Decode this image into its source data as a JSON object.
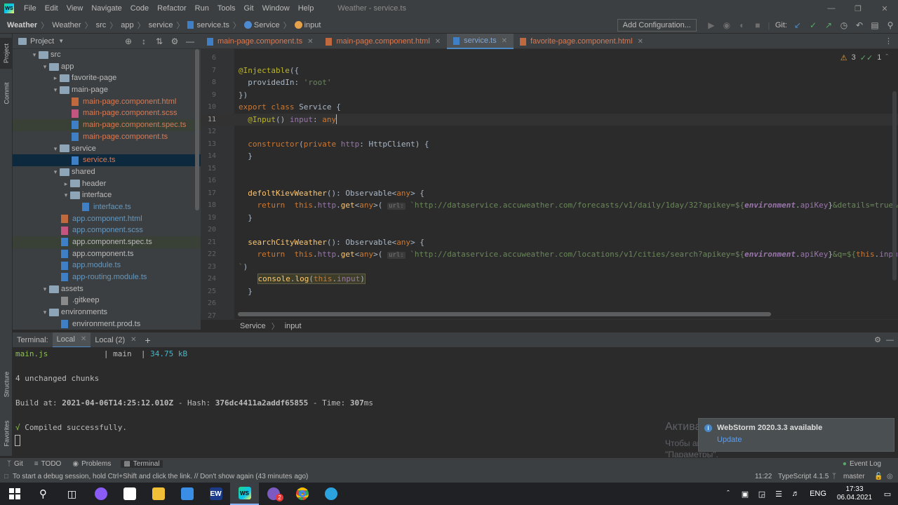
{
  "titlebar": {
    "logo": "WS",
    "menu": [
      "File",
      "Edit",
      "View",
      "Navigate",
      "Code",
      "Refactor",
      "Run",
      "Tools",
      "Git",
      "Window",
      "Help"
    ],
    "window_title": "Weather - service.ts"
  },
  "navbar": {
    "crumbs": [
      "Weather",
      "Weather",
      "src",
      "app",
      "service",
      "service.ts",
      "Service",
      "input"
    ],
    "add_config": "Add Configuration...",
    "git_label": "Git:"
  },
  "left_strip": {
    "project": "Project",
    "commit": "Commit",
    "structure": "Structure",
    "favorites": "Favorites"
  },
  "project": {
    "title": "Project",
    "tree": [
      {
        "label": "src",
        "type": "dir",
        "indent": 1,
        "arrow": "▾"
      },
      {
        "label": "app",
        "type": "dir",
        "indent": 2,
        "arrow": "▾"
      },
      {
        "label": "favorite-page",
        "type": "dir",
        "indent": 3,
        "arrow": "▸"
      },
      {
        "label": "main-page",
        "type": "dir",
        "indent": 3,
        "arrow": "▾"
      },
      {
        "label": "main-page.component.html",
        "type": "html",
        "indent": 4,
        "arrow": "",
        "color": "red"
      },
      {
        "label": "main-page.component.scss",
        "type": "scss",
        "indent": 4,
        "arrow": "",
        "color": "red"
      },
      {
        "label": "main-page.component.spec.ts",
        "type": "ts",
        "indent": 4,
        "arrow": "",
        "color": "red",
        "hl": true
      },
      {
        "label": "main-page.component.ts",
        "type": "ts",
        "indent": 4,
        "arrow": "",
        "color": "red"
      },
      {
        "label": "service",
        "type": "dir",
        "indent": 3,
        "arrow": "▾"
      },
      {
        "label": "service.ts",
        "type": "ts",
        "indent": 4,
        "arrow": "",
        "color": "red",
        "sel": true
      },
      {
        "label": "shared",
        "type": "dir",
        "indent": 3,
        "arrow": "▾"
      },
      {
        "label": "header",
        "type": "dir",
        "indent": 4,
        "arrow": "▸"
      },
      {
        "label": "interface",
        "type": "dir",
        "indent": 4,
        "arrow": "▾"
      },
      {
        "label": "interface.ts",
        "type": "ts",
        "indent": 5,
        "arrow": "",
        "color": "blue"
      },
      {
        "label": "app.component.html",
        "type": "html",
        "indent": 3,
        "arrow": "",
        "color": "blue"
      },
      {
        "label": "app.component.scss",
        "type": "scss",
        "indent": 3,
        "arrow": "",
        "color": "blue"
      },
      {
        "label": "app.component.spec.ts",
        "type": "ts",
        "indent": 3,
        "arrow": "",
        "color": "normal",
        "hl": true
      },
      {
        "label": "app.component.ts",
        "type": "ts",
        "indent": 3,
        "arrow": "",
        "color": "normal"
      },
      {
        "label": "app.module.ts",
        "type": "ts",
        "indent": 3,
        "arrow": "",
        "color": "blue"
      },
      {
        "label": "app-routing.module.ts",
        "type": "ts",
        "indent": 3,
        "arrow": "",
        "color": "blue"
      },
      {
        "label": "assets",
        "type": "dir",
        "indent": 2,
        "arrow": "▾"
      },
      {
        "label": ".gitkeep",
        "type": "gen",
        "indent": 3,
        "arrow": "",
        "color": "normal"
      },
      {
        "label": "environments",
        "type": "dir",
        "indent": 2,
        "arrow": "▾"
      },
      {
        "label": "environment.prod.ts",
        "type": "ts",
        "indent": 3,
        "arrow": "",
        "color": "normal"
      }
    ]
  },
  "tabs": [
    {
      "label": "main-page.component.ts",
      "kind": "ts",
      "active": false
    },
    {
      "label": "main-page.component.html",
      "kind": "html",
      "active": false
    },
    {
      "label": "service.ts",
      "kind": "ts",
      "active": true
    },
    {
      "label": "favorite-page.component.html",
      "kind": "html",
      "active": false
    }
  ],
  "editor": {
    "inspections": {
      "warnings": "3",
      "checks": "1"
    },
    "line_numbers": [
      "6",
      "7",
      "8",
      "9",
      "10",
      "11",
      "12",
      "13",
      "14",
      "15",
      "16",
      "17",
      "18",
      "19",
      "20",
      "21",
      "22",
      "23",
      "24",
      "25",
      "26",
      "27"
    ],
    "url_hint": "url:",
    "url1": "`http://dataservice.accuweather.com/forecasts/v1/daily/1day/32?apikey=${",
    "url2": "`http://dataservice.accuweather.com/locations/v1/cities/search?apikey=${",
    "tail1": "}&details=true&m",
    "tail2": "}&q=${",
    "this_input": "this.input"
  },
  "code_breadcrumb": [
    "Service",
    "input"
  ],
  "terminal": {
    "label": "Terminal:",
    "tabs": [
      "Local",
      "Local (2)"
    ],
    "lines": {
      "l1_file": "main.js",
      "l1_sep": "| main",
      "l1_size": "34.75 kB",
      "l2": "4 unchanged chunks",
      "l3_pre": "Build at:",
      "l3_date": "2021-04-06T14:25:12.010Z",
      "l3_mid": "- Hash:",
      "l3_hash": "376dc4411a2addf65855",
      "l3_time_lbl": "- Time:",
      "l3_time": "307",
      "l3_unit": "ms",
      "l4_check": "√",
      "l4": "Compiled successfully."
    }
  },
  "watermark": {
    "line1": "Активация Windows",
    "line2": "Чтобы активировать Windows, перейдите в раздел",
    "line3": "\"Параметры\"."
  },
  "notification": {
    "title": "WebStorm 2020.3.3 available",
    "link": "Update"
  },
  "bottom_tools": [
    "Git",
    "TODO",
    "Problems",
    "Terminal"
  ],
  "event_log": "Event Log",
  "status": {
    "message": "To start a debug session, hold Ctrl+Shift and click the link. // Don't show again (43 minutes ago)",
    "position": "11:22",
    "lang": "TypeScript 4.1.5",
    "branch": "master"
  },
  "taskbar": {
    "lang": "ENG",
    "time": "17:33",
    "date": "06.04.2021",
    "ew": "EW",
    "ws": "WS",
    "viber_badge": "2"
  }
}
